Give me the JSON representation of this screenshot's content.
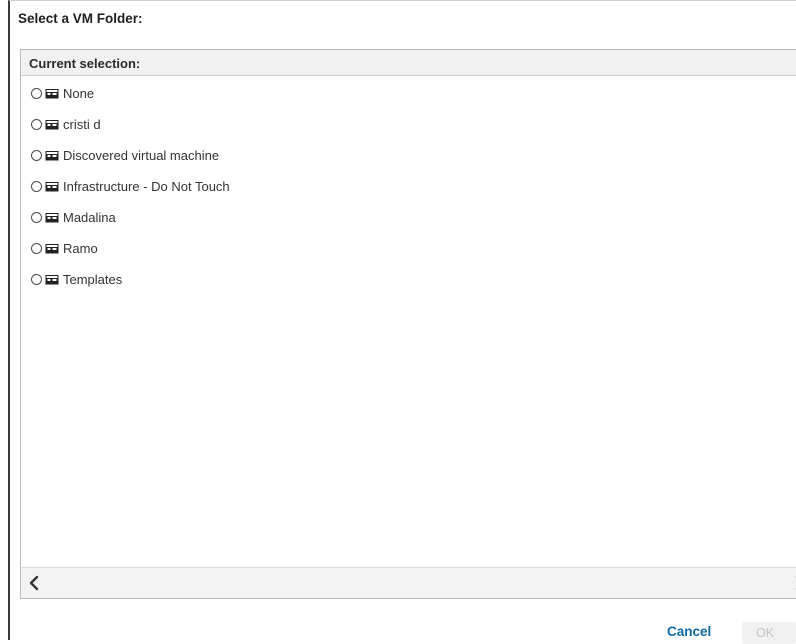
{
  "dialog": {
    "title": "Select a VM Folder:",
    "cancel_label": "Cancel",
    "ok_label": "OK"
  },
  "panel": {
    "header": "Current selection:",
    "items": [
      {
        "label": "None",
        "icon": "folder-icon",
        "selected": false
      },
      {
        "label": "cristi d",
        "icon": "folder-icon",
        "selected": false
      },
      {
        "label": "Discovered virtual machine",
        "icon": "folder-icon",
        "selected": false
      },
      {
        "label": "Infrastructure - Do Not Touch",
        "icon": "folder-icon",
        "selected": false
      },
      {
        "label": "Madalina",
        "icon": "folder-icon",
        "selected": false
      },
      {
        "label": "Ramo",
        "icon": "folder-icon",
        "selected": false
      },
      {
        "label": "Templates",
        "icon": "folder-icon",
        "selected": false
      }
    ]
  },
  "colors": {
    "accent": "#0d6aa6",
    "disabled_text": "#c3c3c3"
  }
}
